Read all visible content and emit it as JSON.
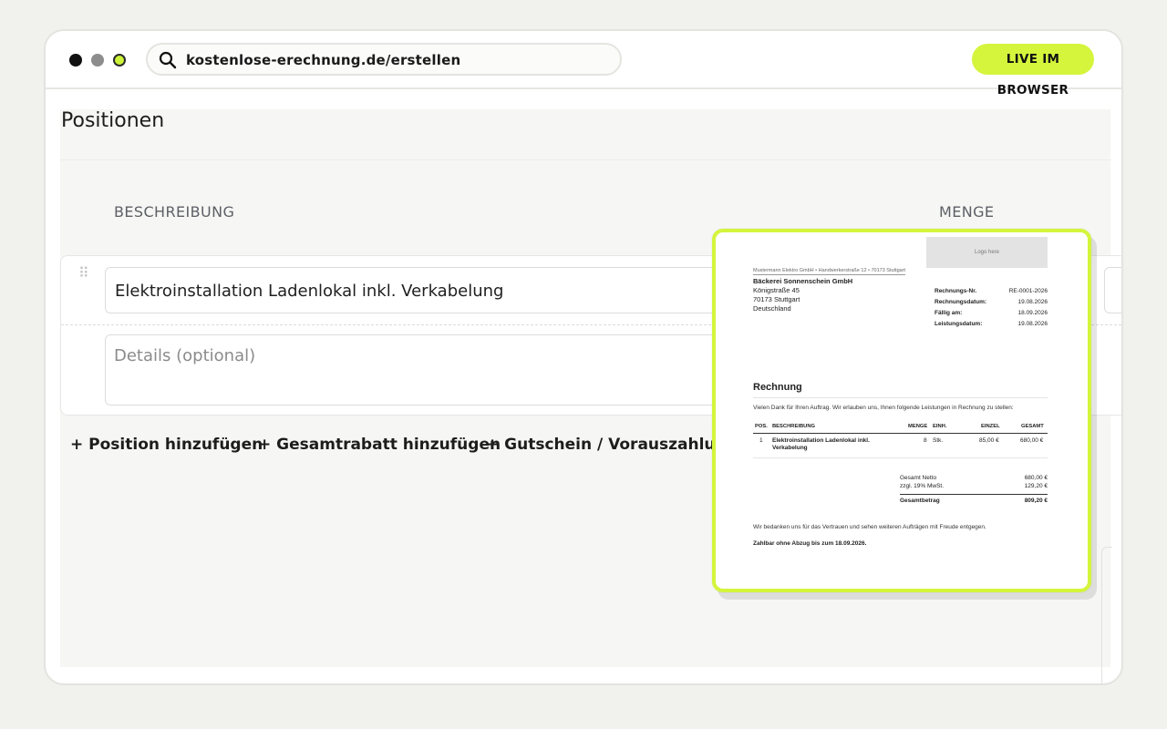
{
  "browser": {
    "url": "kostenlose-erechnung.de/erstellen",
    "badge": "LIVE IM BROWSER",
    "accent": "#d4f53c"
  },
  "positions": {
    "title": "Positionen",
    "col_description": "BESCHREIBUNG",
    "col_quantity": "MENGE",
    "item_description": "Elektroinstallation Ladenlokal inkl. Verkabelung",
    "details_placeholder": "Details (optional)",
    "add_position": "+ Position hinzufügen",
    "add_discount": "+ Gesamtrabatt hinzufügen",
    "add_voucher": "+ Gutschein / Vorauszahlung hi"
  },
  "invoice": {
    "logo": "Logo here",
    "sender": "Mustermann Elektro GmbH • Handwerkerstraße 12 • 70173 Stuttgart",
    "recipient_name": "Bäckerei Sonnenschein GmbH",
    "recipient_street": "Königstraße 45",
    "recipient_city": "70173 Stuttgart",
    "recipient_country": "Deutschland",
    "meta": [
      {
        "label": "Rechnungs-Nr.",
        "value": "RE-0001-2026"
      },
      {
        "label": "Rechnungsdatum:",
        "value": "19.08.2026"
      },
      {
        "label": "Fällig am:",
        "value": "18.09.2026"
      },
      {
        "label": "Leistungsdatum:",
        "value": "19.08.2026"
      }
    ],
    "title": "Rechnung",
    "intro": "Vielen Dank für Ihren Auftrag. Wir erlauben uns, Ihnen folgende Leistungen in Rechnung zu stellen:",
    "table_headers": {
      "pos": "POS.",
      "desc": "BESCHREIBUNG",
      "qty": "MENGE",
      "unit": "EINH.",
      "single": "EINZEL",
      "total": "GESAMT"
    },
    "row": {
      "pos": "1",
      "desc": "Elektroinstallation Ladenlokal inkl. Verkabelung",
      "qty": "8",
      "unit": "Stk.",
      "single": "85,00 €",
      "total": "680,00 €"
    },
    "totals": [
      {
        "label": "Gesamt Netto",
        "value": "680,00 €"
      },
      {
        "label": "zzgl. 19% MwSt.",
        "value": "129,20 €"
      }
    ],
    "grand_label": "Gesamtbetrag",
    "grand_value": "809,20 €",
    "thanks": "Wir bedanken uns für das Vertrauen und sehen weiteren Aufträgen mit Freude entgegen.",
    "payment": "Zahlbar ohne Abzug bis zum 18.09.2026."
  }
}
